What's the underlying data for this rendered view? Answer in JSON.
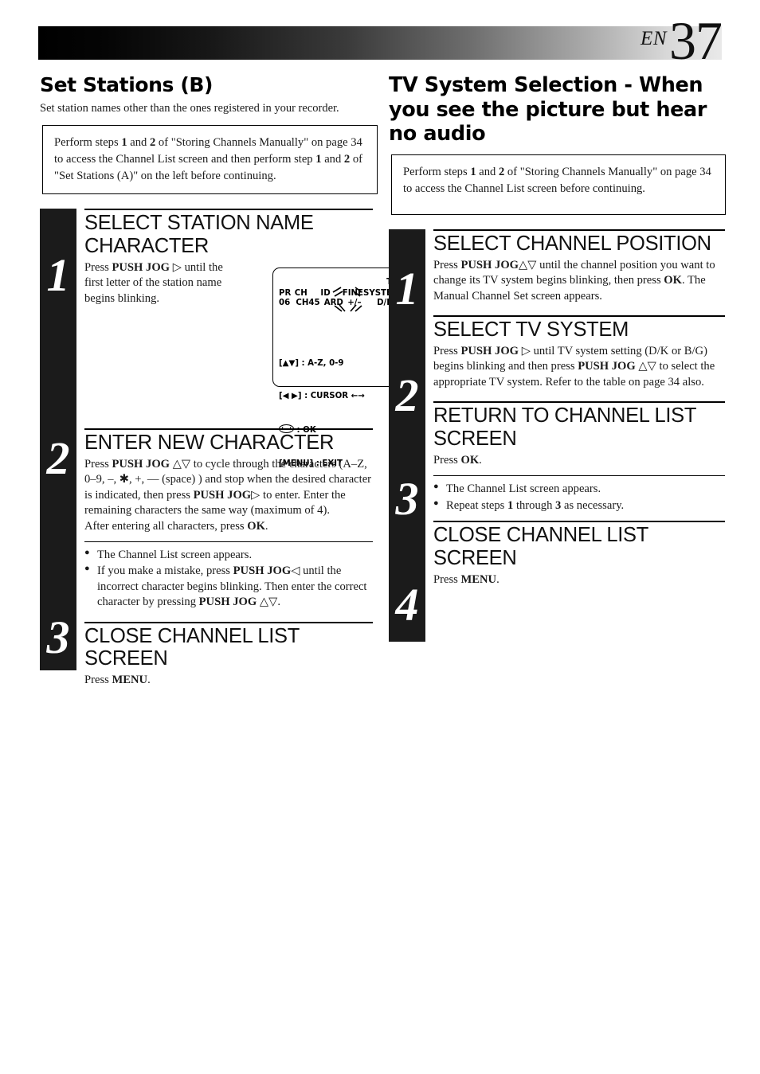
{
  "header": {
    "lang_code": "EN",
    "page_number": "37"
  },
  "left_column": {
    "title": "Set Stations (B)",
    "subtitle": "Set station names other than the ones registered in your recorder.",
    "note": "Perform steps 1 and 2 of \"Storing Channels Manually\" on page 34 to access the Channel List screen and then perform step 1 and 2 of \"Set Stations (A)\" on the left before continuing.",
    "note_parts": {
      "p1": "Perform steps ",
      "b1": "1",
      "p2": " and ",
      "b2": "2",
      "p3": " of \"Storing Channels Manually\" on page 34 to access the Channel List screen and then perform step ",
      "b3": "1",
      "p4": " and ",
      "b4": "2",
      "p5": " of \"Set Stations (A)\" on the left before continuing."
    },
    "steps": [
      {
        "number": "1",
        "heading": "SELECT STATION NAME CHARACTER",
        "text_parts": {
          "p1": "Press ",
          "b1": "PUSH JOG",
          "p2": " ▷ until the first letter of the station name begins blinking."
        }
      },
      {
        "number": "2",
        "heading": "ENTER NEW CHARACTER",
        "text_parts": {
          "p1": "Press ",
          "b1": "PUSH JOG",
          "p2": " △▽ to cycle through the characters (A–Z, 0–9, –, ✱, +, — (space) ) and stop when the desired character is indicated, then press ",
          "b2": "PUSH JOG",
          "p3": "▷ to enter. Enter the remaining characters the same way (maximum of 4).",
          "p4": "After entering all characters, press ",
          "b3": "OK",
          "p5": "."
        },
        "bullets": [
          {
            "p1": "The Channel List screen appears."
          },
          {
            "p1": "If you make a mistake, press ",
            "b1": "PUSH JOG",
            "p2": "◁ until the incorrect character begins blinking. Then enter the correct character by pressing ",
            "b2": "PUSH JOG",
            "p3": " △▽."
          }
        ]
      },
      {
        "number": "3",
        "heading": "CLOSE CHANNEL LIST SCREEN",
        "text_parts": {
          "p1": "Press ",
          "b1": "MENU",
          "p2": "."
        }
      }
    ],
    "osd": {
      "tv_label": "TV",
      "headers": [
        "PR",
        "CH",
        "ID",
        "FINE",
        "SYSTEM"
      ],
      "values": [
        "06",
        "CH45",
        "ARD",
        "+/–",
        "D/K"
      ],
      "blinking_field": "ARD",
      "legend": [
        {
          "key": "[▲▼]",
          "sep": " : ",
          "value": "A-Z, 0-9"
        },
        {
          "key": "[◀ ▶]",
          "sep": " : ",
          "value": "CURSOR ←→"
        },
        {
          "key": "OK-BUTTON",
          "sep": " : ",
          "value": "OK"
        },
        {
          "key": "[MENU]",
          "sep": " : ",
          "value": "EXIT"
        }
      ]
    }
  },
  "right_column": {
    "title": "TV System Selection - When you see the picture but hear no audio",
    "note_parts": {
      "p1": "Perform steps ",
      "b1": "1",
      "p2": " and ",
      "b2": "2",
      "p3": " of \"Storing Channels Manually\" on page 34 to access the Channel List screen before continuing."
    },
    "steps": [
      {
        "number": "1",
        "heading": "SELECT CHANNEL POSITION",
        "text_parts": {
          "p1": "Press ",
          "b1": "PUSH JOG",
          "p2": "△▽ until the channel position you want to change its TV system begins blinking, then press ",
          "b2": "OK",
          "p3": ". The Manual Channel Set screen appears."
        }
      },
      {
        "number": "2",
        "heading": "SELECT TV SYSTEM",
        "text_parts": {
          "p1": "Press ",
          "b1": "PUSH JOG",
          "p2": " ▷ until TV system setting (D/K or B/G) begins blinking and then press ",
          "b2": "PUSH JOG",
          "p3": " △▽ to select the appropriate TV system. Refer to the table on page 34 also."
        }
      },
      {
        "number": "3",
        "heading": "RETURN TO CHANNEL LIST SCREEN",
        "text_parts": {
          "p1": "Press ",
          "b1": "OK",
          "p2": "."
        },
        "bullets": [
          {
            "p1": "The Channel List screen appears."
          },
          {
            "p1": "Repeat steps ",
            "b1": "1",
            "p2": " through ",
            "b2": "3",
            "p3": " as necessary."
          }
        ]
      },
      {
        "number": "4",
        "heading": "CLOSE CHANNEL LIST SCREEN",
        "text_parts": {
          "p1": "Press ",
          "b1": "MENU",
          "p2": "."
        }
      }
    ]
  }
}
